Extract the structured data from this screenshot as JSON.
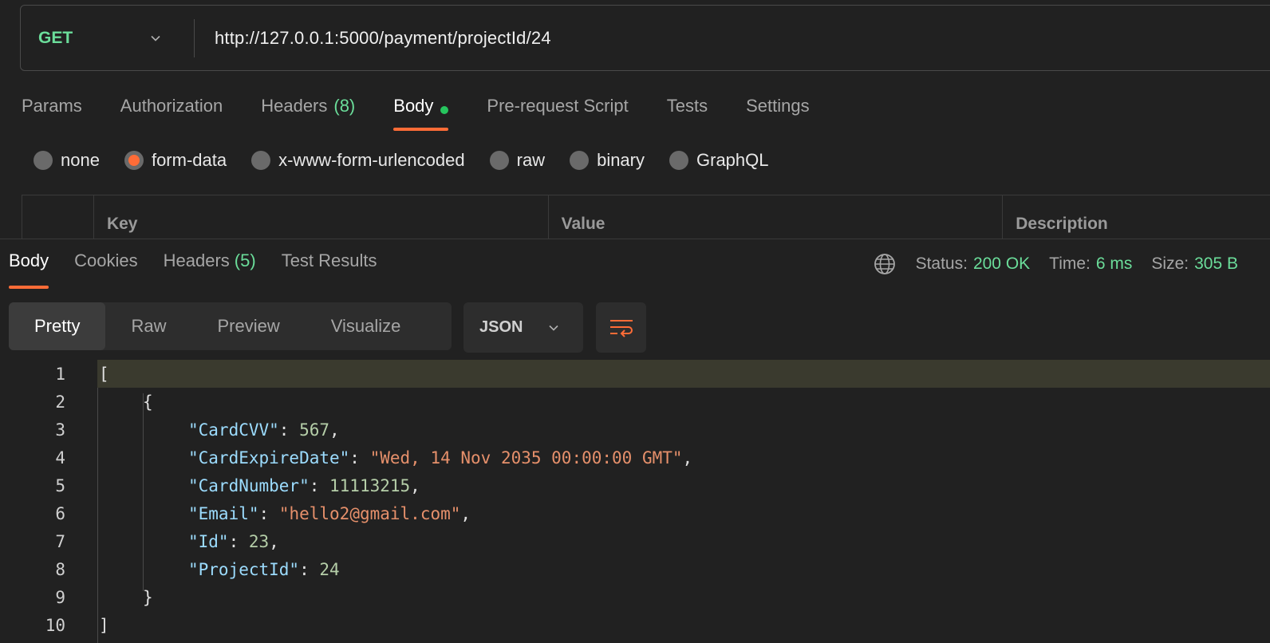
{
  "request": {
    "method": "GET",
    "url": "http://127.0.0.1:5000/payment/projectId/24"
  },
  "request_tabs": [
    {
      "label": "Params"
    },
    {
      "label": "Authorization"
    },
    {
      "label": "Headers",
      "count": "(8)"
    },
    {
      "label": "Body",
      "active": true
    },
    {
      "label": "Pre-request Script"
    },
    {
      "label": "Tests"
    },
    {
      "label": "Settings"
    }
  ],
  "body_modes": [
    {
      "label": "none"
    },
    {
      "label": "form-data",
      "selected": true
    },
    {
      "label": "x-www-form-urlencoded"
    },
    {
      "label": "raw"
    },
    {
      "label": "binary"
    },
    {
      "label": "GraphQL"
    }
  ],
  "kv_table": {
    "headers": [
      "Key",
      "Value",
      "Description"
    ]
  },
  "response_tabs": [
    {
      "label": "Body",
      "active": true
    },
    {
      "label": "Cookies"
    },
    {
      "label": "Headers",
      "count": "(5)"
    },
    {
      "label": "Test Results"
    }
  ],
  "status": {
    "status_label": "Status:",
    "status_value": "200 OK",
    "time_label": "Time:",
    "time_value": "6 ms",
    "size_label": "Size:",
    "size_value": "305 B"
  },
  "view_modes": [
    "Pretty",
    "Raw",
    "Preview",
    "Visualize"
  ],
  "format": "JSON",
  "colors": {
    "accent": "#ff6c37",
    "success": "#6bdd9a",
    "json_key": "#9cdcfe",
    "json_string": "#e6906b",
    "json_number": "#b5cea8"
  },
  "line_numbers": [
    "1",
    "2",
    "3",
    "4",
    "5",
    "6",
    "7",
    "8",
    "9",
    "10"
  ],
  "json_body": {
    "open_bracket": "[",
    "open_brace": "{",
    "close_brace": "}",
    "close_bracket": "]",
    "fields": [
      {
        "key": "\"CardCVV\"",
        "value": "567",
        "type": "number",
        "comma": ","
      },
      {
        "key": "\"CardExpireDate\"",
        "value": "\"Wed, 14 Nov 2035 00:00:00 GMT\"",
        "type": "string",
        "comma": ","
      },
      {
        "key": "\"CardNumber\"",
        "value": "11113215",
        "type": "number",
        "comma": ","
      },
      {
        "key": "\"Email\"",
        "value": "\"hello2@gmail.com\"",
        "type": "string",
        "comma": ","
      },
      {
        "key": "\"Id\"",
        "value": "23",
        "type": "number",
        "comma": ","
      },
      {
        "key": "\"ProjectId\"",
        "value": "24",
        "type": "number",
        "comma": ""
      }
    ]
  }
}
